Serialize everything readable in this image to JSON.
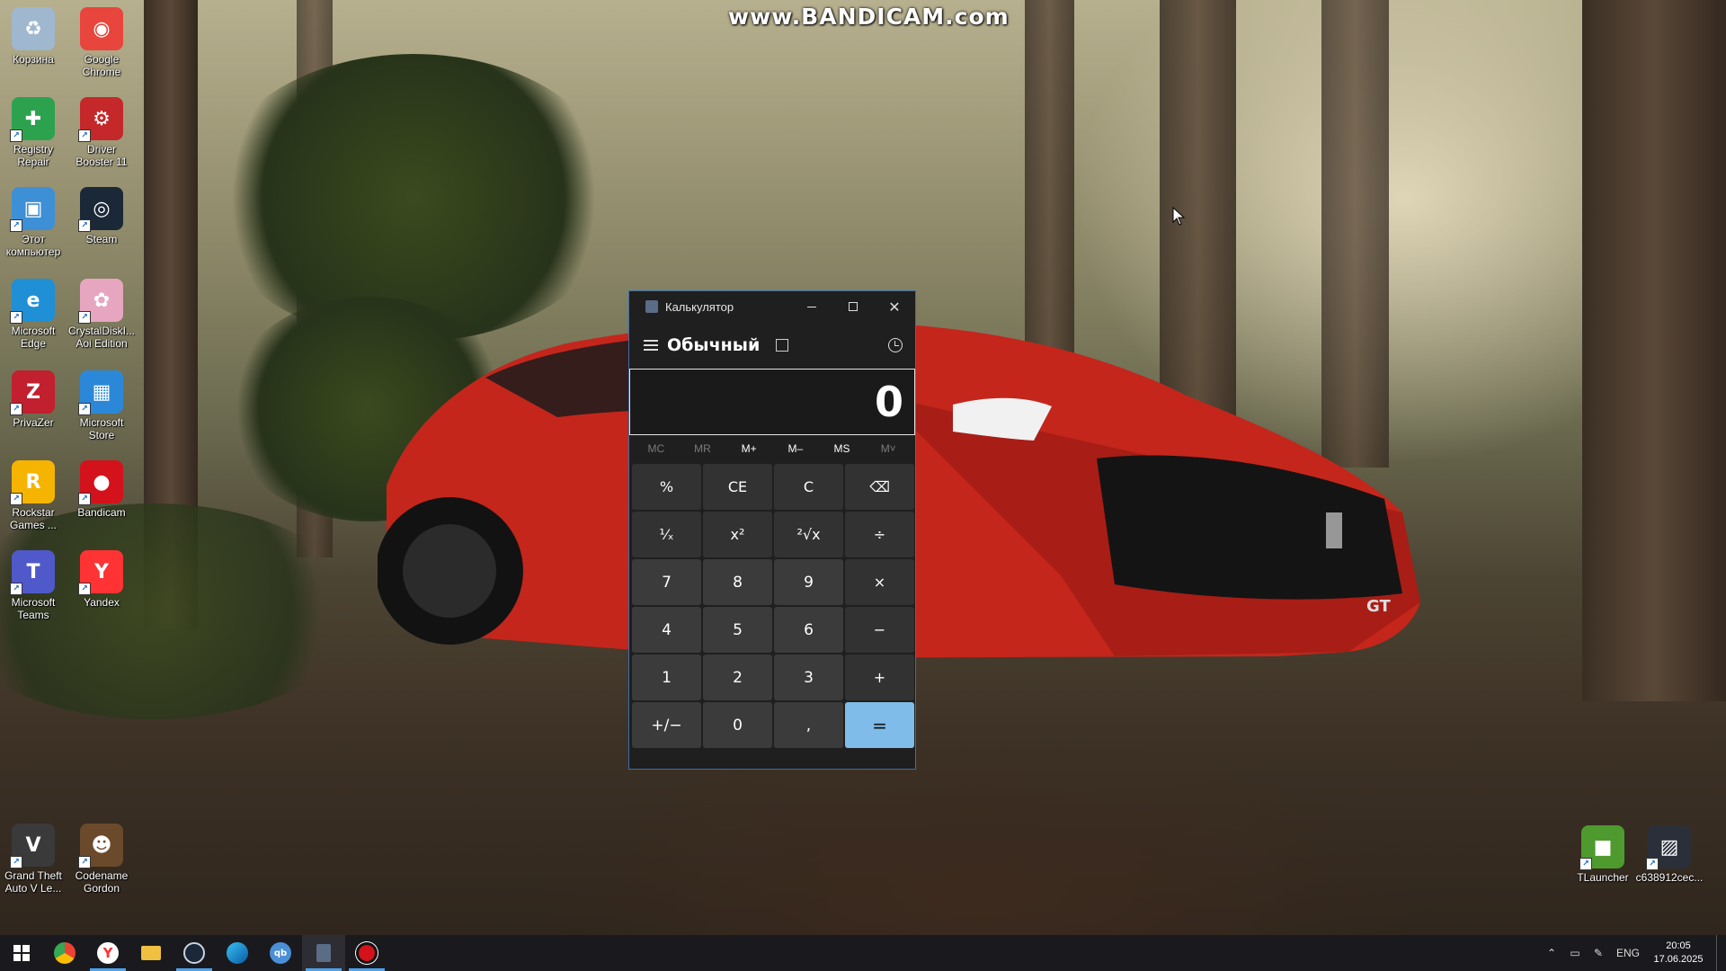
{
  "watermark": "www.BANDICAM.com",
  "desktop_icons": [
    {
      "name": "recycle-bin",
      "label": "Корзина",
      "icon": "recycle-bin-icon",
      "color": "#9fb7cf"
    },
    {
      "name": "google-chrome",
      "label": "Google\nChrome",
      "icon": "chrome-icon",
      "color": "#e8453c"
    },
    {
      "name": "registry-repair",
      "label": "Registry\nRepair",
      "icon": "registry-repair-icon",
      "color": "#2ca24f"
    },
    {
      "name": "driver-booster",
      "label": "Driver\nBooster 11",
      "icon": "driver-booster-icon",
      "color": "#c5282a"
    },
    {
      "name": "this-pc",
      "label": "Этот\nкомпьютер",
      "icon": "computer-icon",
      "color": "#3d8fd6"
    },
    {
      "name": "steam",
      "label": "Steam",
      "icon": "steam-icon",
      "color": "#1b2838"
    },
    {
      "name": "microsoft-edge",
      "label": "Microsoft\nEdge",
      "icon": "edge-icon",
      "color": "#1f8fd6"
    },
    {
      "name": "crystaldiskinfo",
      "label": "CrystalDiskI...\nAoi Edition",
      "icon": "crystaldisk-icon",
      "color": "#e7a6c0"
    },
    {
      "name": "privazer",
      "label": "PrivaZer",
      "icon": "privazer-icon",
      "color": "#c21f2f"
    },
    {
      "name": "microsoft-store",
      "label": "Microsoft\nStore",
      "icon": "store-icon",
      "color": "#2b88d8"
    },
    {
      "name": "rockstar-games",
      "label": "Rockstar\nGames ...",
      "icon": "rockstar-icon",
      "color": "#f4b400"
    },
    {
      "name": "bandicam",
      "label": "Bandicam",
      "icon": "bandicam-icon",
      "color": "#d3121c"
    },
    {
      "name": "microsoft-teams",
      "label": "Microsoft\nTeams",
      "icon": "teams-icon",
      "color": "#5059c9"
    },
    {
      "name": "yandex",
      "label": "Yandex",
      "icon": "yandex-icon",
      "color": "#f33"
    },
    {
      "name": "gta-v",
      "label": "Grand Theft\nAuto V Le...",
      "icon": "gta-icon",
      "color": "#3a3a3a"
    },
    {
      "name": "codename-gordon",
      "label": "Codename\nGordon",
      "icon": "gordon-icon",
      "color": "#6b4a2b"
    },
    {
      "name": "tlauncher",
      "label": "TLauncher",
      "icon": "tlauncher-icon",
      "color": "#4f9a2e"
    },
    {
      "name": "c638912cec",
      "label": "c638912cec...",
      "icon": "image-file-icon",
      "color": "#2b2f3a"
    }
  ],
  "calculator": {
    "title": "Калькулятор",
    "mode": "Обычный",
    "display": "0",
    "memory": [
      "MC",
      "MR",
      "M+",
      "M–",
      "MS",
      "M˅"
    ],
    "keys": [
      "%",
      "CE",
      "C",
      "⌫",
      "¹⁄ₓ",
      "x²",
      "²√x",
      "÷",
      "7",
      "8",
      "9",
      "×",
      "4",
      "5",
      "6",
      "−",
      "1",
      "2",
      "3",
      "+",
      "+/−",
      "0",
      ",",
      "="
    ],
    "accent": "#7fbce9"
  },
  "taskbar": {
    "language": "ENG",
    "time": "20:05",
    "date": "17.06.2025"
  }
}
